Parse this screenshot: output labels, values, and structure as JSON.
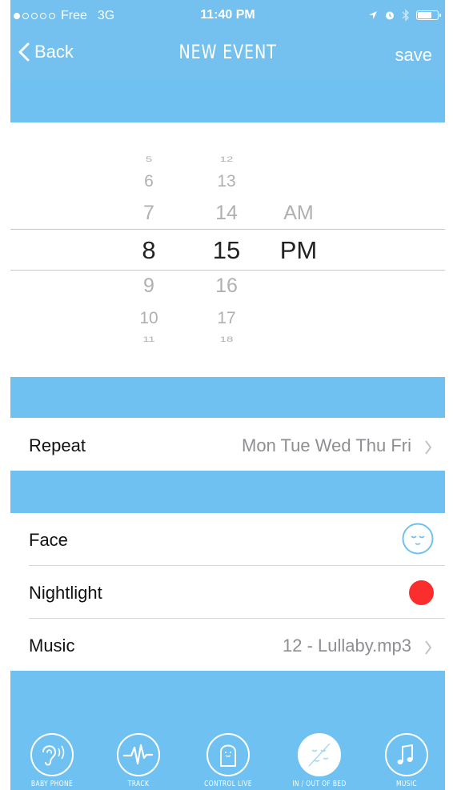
{
  "status_bar": {
    "carrier": "Free",
    "network": "3G",
    "time": "11:40 PM"
  },
  "nav": {
    "back_label": "Back",
    "title": "NEW EVENT",
    "save_label": "save"
  },
  "picker": {
    "hours": [
      "5",
      "6",
      "7",
      "8",
      "9",
      "10",
      "11"
    ],
    "minutes": [
      "12",
      "13",
      "14",
      "15",
      "16",
      "17",
      "18"
    ],
    "ampm": [
      "AM",
      "PM"
    ],
    "selected_hour": "8",
    "selected_minute": "15",
    "selected_ampm": "PM"
  },
  "rows": {
    "repeat": {
      "label": "Repeat",
      "value": "Mon Tue Wed Thu Fri"
    },
    "face": {
      "label": "Face"
    },
    "nightlight": {
      "label": "Nightlight",
      "color": "#fc2d2d"
    },
    "music": {
      "label": "Music",
      "value": "12 - Lullaby.mp3"
    }
  },
  "tabs": [
    {
      "label": "BABY PHONE",
      "icon": "ear-icon"
    },
    {
      "label": "TRACK",
      "icon": "heartbeat-icon"
    },
    {
      "label": "CONTROL LIVE",
      "icon": "device-icon"
    },
    {
      "label": "IN / OUT OF BED",
      "icon": "sleeping-face-icon",
      "active": true
    },
    {
      "label": "MUSIC",
      "icon": "music-note-icon"
    }
  ],
  "colors": {
    "accent": "#6ec1f0",
    "nightlight": "#fc2d2d"
  }
}
